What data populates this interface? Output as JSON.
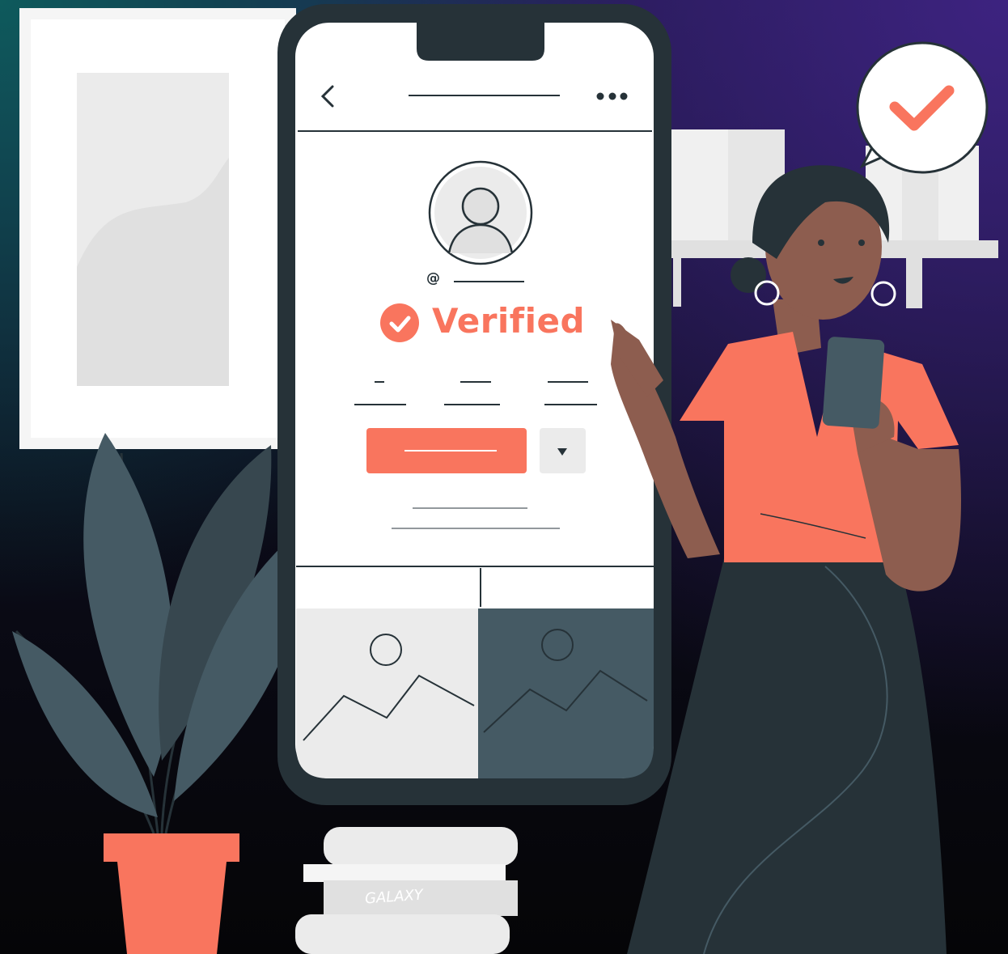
{
  "phone": {
    "handle_prefix": "@",
    "verified_label": "Verified"
  },
  "books": {
    "spine_title": "GALAXY"
  },
  "colors": {
    "accent": "#f9755e",
    "dark": "#263238",
    "slate": "#455a64",
    "paper": "#ebebeb"
  },
  "icons": [
    "back-chevron-icon",
    "more-dots-icon",
    "avatar-icon",
    "verified-check-icon",
    "dropdown-arrow-icon",
    "image-placeholder-icon",
    "checkmark-bubble-icon"
  ]
}
